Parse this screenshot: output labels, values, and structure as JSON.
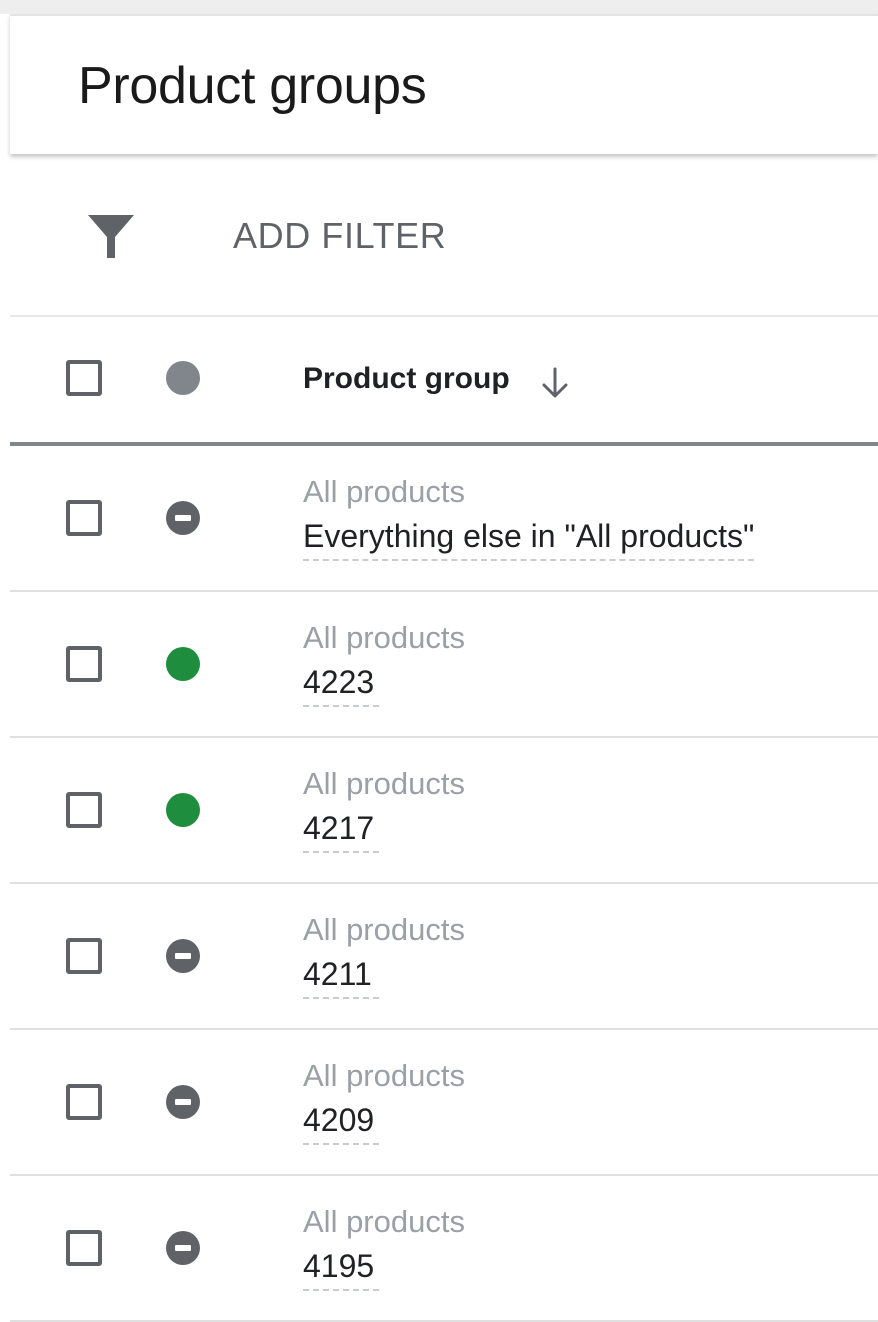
{
  "header": {
    "title": "Product groups"
  },
  "filter": {
    "icon": "filter-icon",
    "label": "ADD FILTER"
  },
  "table": {
    "column_header": "Product group",
    "sort_icon": "arrow-down-icon",
    "header_status_color": "#80868b",
    "status_colors": {
      "enabled": "#1e8e3e",
      "paused": "#5f6368"
    },
    "rows": [
      {
        "parent": "All products",
        "name": "Everything else in \"All products\"",
        "status": "paused"
      },
      {
        "parent": "All products",
        "name": "4223",
        "status": "enabled"
      },
      {
        "parent": "All products",
        "name": "4217",
        "status": "enabled"
      },
      {
        "parent": "All products",
        "name": "4211",
        "status": "paused"
      },
      {
        "parent": "All products",
        "name": "4209",
        "status": "paused"
      },
      {
        "parent": "All products",
        "name": "4195",
        "status": "paused"
      }
    ]
  }
}
